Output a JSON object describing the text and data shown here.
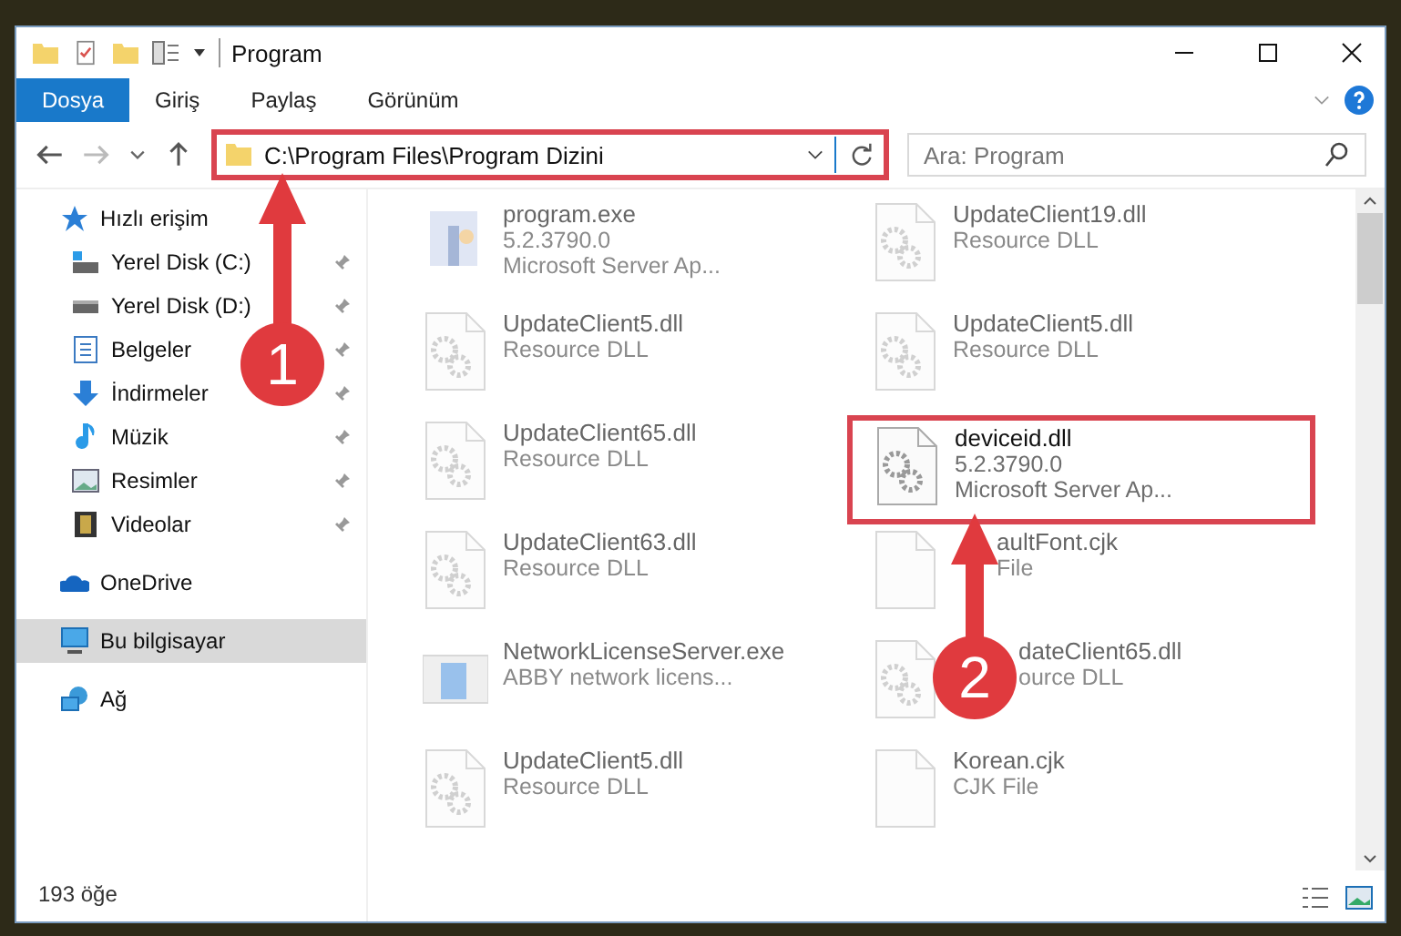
{
  "window": {
    "title": "Program"
  },
  "ribbon_tabs": [
    {
      "label": "Dosya",
      "selected": true
    },
    {
      "label": "Giriş",
      "selected": false
    },
    {
      "label": "Paylaş",
      "selected": false
    },
    {
      "label": "Görünüm",
      "selected": false
    }
  ],
  "address": {
    "path": "C:\\Program Files\\Program Dizini",
    "highlighted": true
  },
  "search": {
    "placeholder": "Ara: Program"
  },
  "sidebar": {
    "items": [
      {
        "label": "Hızlı erişim",
        "kind": "quick",
        "selected": false,
        "children": [
          {
            "label": "Yerel Disk (C:)",
            "kind": "diskc",
            "selected": false,
            "pinned": true
          },
          {
            "label": "Yerel Disk (D:)",
            "kind": "disk",
            "selected": false,
            "pinned": true
          },
          {
            "label": "Belgeler",
            "kind": "docs",
            "selected": false,
            "pinned": true
          },
          {
            "label": "İndirmeler",
            "kind": "down",
            "selected": false,
            "pinned": true
          },
          {
            "label": "Müzik",
            "kind": "music",
            "selected": false,
            "pinned": true
          },
          {
            "label": "Resimler",
            "kind": "pics",
            "selected": false,
            "pinned": true
          },
          {
            "label": "Videolar",
            "kind": "video",
            "selected": false,
            "pinned": true
          }
        ]
      },
      {
        "label": "OneDrive",
        "kind": "cloud",
        "selected": false
      },
      {
        "label": "Bu bilgisayar",
        "kind": "pc",
        "selected": true
      },
      {
        "label": "Ağ",
        "kind": "net",
        "selected": false
      }
    ]
  },
  "files": [
    {
      "name": "program.exe",
      "lines": [
        "5.2.3790.0",
        "Microsoft Server Ap..."
      ],
      "kind": "app",
      "faded": true,
      "highlighted": false
    },
    {
      "name": "UpdateClient19.dll",
      "lines": [
        "Resource DLL"
      ],
      "kind": "dll",
      "faded": true,
      "highlighted": false
    },
    {
      "name": "UpdateClient5.dll",
      "lines": [
        "Resource DLL"
      ],
      "kind": "dll",
      "faded": true,
      "highlighted": false
    },
    {
      "name": "UpdateClient5.dll",
      "lines": [
        "Resource DLL"
      ],
      "kind": "dll",
      "faded": true,
      "highlighted": false
    },
    {
      "name": "UpdateClient65.dll",
      "lines": [
        "Resource DLL"
      ],
      "kind": "dll",
      "faded": true,
      "highlighted": false
    },
    {
      "name": "deviceid.dll",
      "lines": [
        "5.2.3790.0",
        "Microsoft Server Ap..."
      ],
      "kind": "dll",
      "faded": false,
      "highlighted": true
    },
    {
      "name": "UpdateClient63.dll",
      "lines": [
        "Resource DLL"
      ],
      "kind": "dll",
      "faded": true,
      "highlighted": false
    },
    {
      "name": "aultFont.cjk",
      "lines": [
        "File"
      ],
      "kind": "file",
      "faded": true,
      "highlighted": false
    },
    {
      "name": "NetworkLicenseServer.exe",
      "lines": [
        "ABBY network licens..."
      ],
      "kind": "window",
      "faded": true,
      "highlighted": false
    },
    {
      "name": "dateClient65.dll",
      "lines": [
        "ource DLL"
      ],
      "kind": "dll",
      "faded": true,
      "highlighted": false
    },
    {
      "name": "UpdateClient5.dll",
      "lines": [
        "Resource DLL"
      ],
      "kind": "dll",
      "faded": true,
      "highlighted": false
    },
    {
      "name": "Korean.cjk",
      "lines": [
        "CJK File"
      ],
      "kind": "file",
      "faded": true,
      "highlighted": false
    }
  ],
  "callouts": [
    {
      "number": "1"
    },
    {
      "number": "2"
    }
  ],
  "status_bar": {
    "count": "193 öğe"
  }
}
